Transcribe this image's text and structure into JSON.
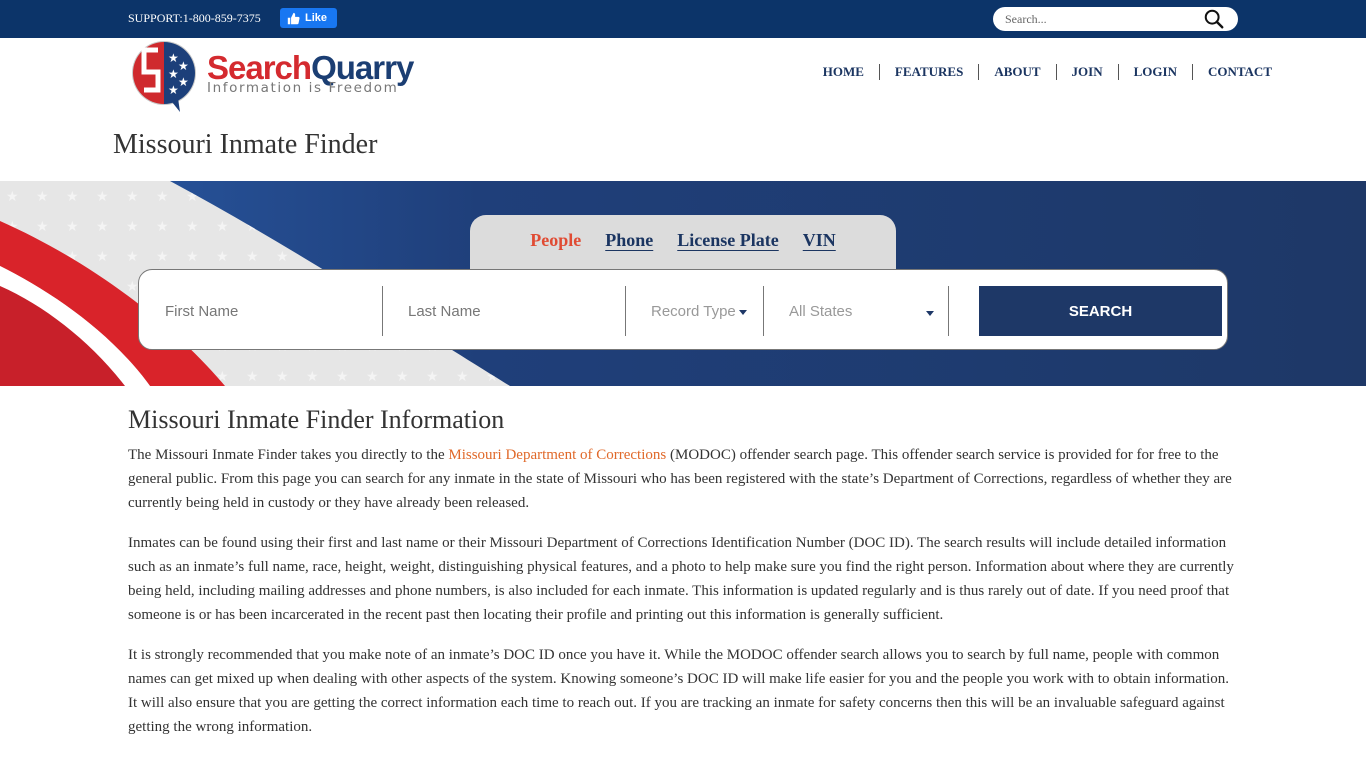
{
  "topbar": {
    "support_text": "SUPPORT:1-800-859-7375",
    "fb_like_label": "Like",
    "search_placeholder": "Search..."
  },
  "logo": {
    "name_part1": "Search",
    "name_part2": "Quarry",
    "tagline": "Information is Freedom"
  },
  "nav": {
    "items": [
      {
        "label": "HOME"
      },
      {
        "label": "FEATURES"
      },
      {
        "label": "ABOUT"
      },
      {
        "label": "JOIN"
      },
      {
        "label": "LOGIN"
      },
      {
        "label": "CONTACT"
      }
    ]
  },
  "page_title": "Missouri Inmate Finder",
  "search": {
    "tabs": [
      {
        "label": "People",
        "active": true
      },
      {
        "label": "Phone",
        "active": false
      },
      {
        "label": "License Plate",
        "active": false
      },
      {
        "label": "VIN",
        "active": false
      }
    ],
    "first_name_placeholder": "First Name",
    "last_name_placeholder": "Last Name",
    "record_type_label": "Record Type",
    "states_label": "All States",
    "button_label": "SEARCH"
  },
  "content": {
    "heading": "Missouri Inmate Finder Information",
    "p1_before": "The Missouri Inmate Finder takes you directly to the ",
    "p1_link": "Missouri Department of Corrections",
    "p1_after": " (MODOC) offender search page. This offender search service is provided for for free to the general public. From this page you can search for any inmate in the state of Missouri who has been registered with the state’s Department of Corrections, regardless of whether they are currently being held in custody or they have already been released.",
    "p2": "Inmates can be found using their first and last name or their Missouri Department of Corrections Identification Number (DOC ID). The search results will include detailed information such as an inmate’s full name, race, height, weight, distinguishing physical features, and a photo to help make sure you find the right person. Information about where they are currently being held, including mailing addresses and phone numbers, is also included for each inmate. This information is updated regularly and is thus rarely out of date. If you need proof that someone is or has been incarcerated in the recent past then locating their profile and printing out this information is generally sufficient.",
    "p3": "It is strongly recommended that you make note of an inmate’s DOC ID once you have it. While the MODOC offender search allows you to search by full name, people with common names can get mixed up when dealing with other aspects of the system. Knowing someone’s DOC ID will make life easier for you and the people you work with to obtain information. It will also ensure that you are getting the correct information each time to reach out. If you are tracking an inmate for safety concerns then this will be an invaluable safeguard against getting the wrong information."
  },
  "colors": {
    "topbar": "#0c3469",
    "navy": "#1e3867",
    "accent_red": "#e04b33",
    "link_orange": "#e0692a"
  }
}
